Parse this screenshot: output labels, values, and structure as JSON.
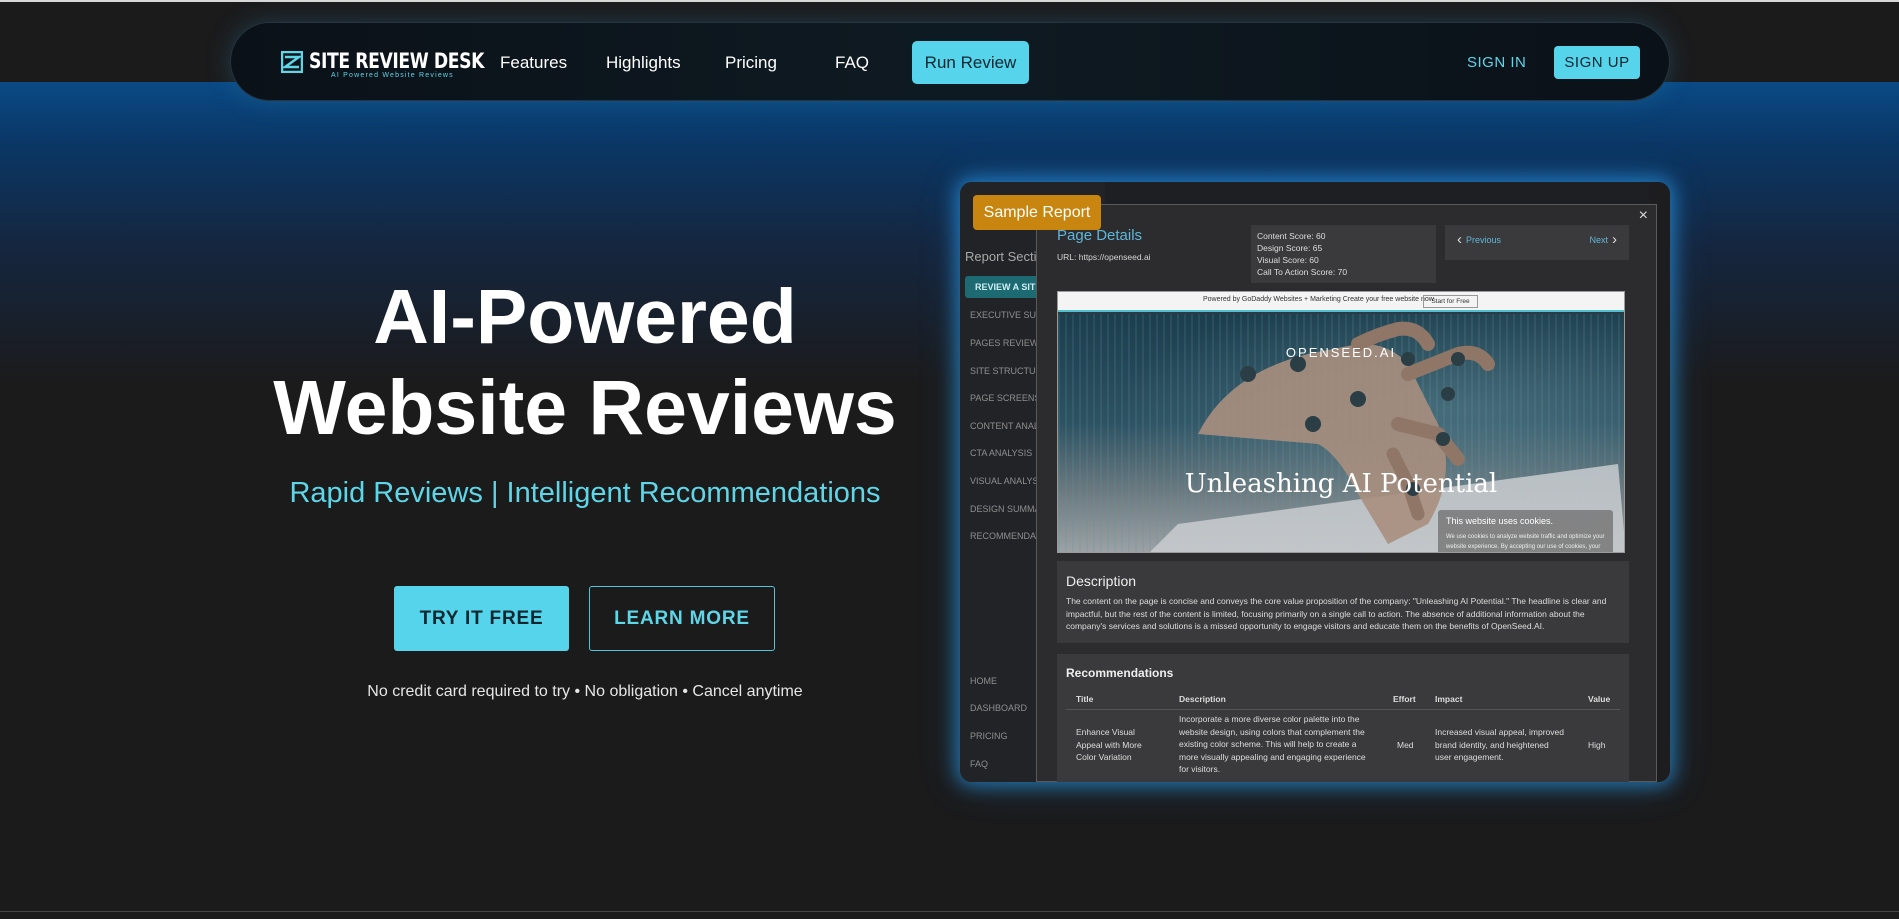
{
  "nav": {
    "logo_title": "SITE REVIEW DESK",
    "logo_subtitle": "AI Powered Website Reviews",
    "links": [
      "Features",
      "Highlights",
      "Pricing",
      "FAQ"
    ],
    "run_review": "Run Review",
    "sign_in": "SIGN IN",
    "sign_up": "SIGN UP"
  },
  "hero": {
    "title_line1": "AI-Powered",
    "title_line2": "Website Reviews",
    "subtitle": "Rapid Reviews | Intelligent Recommendations",
    "try_button": "TRY IT FREE",
    "learn_button": "LEARN MORE",
    "disclaimer": "No credit card required to try • No obligation • Cancel anytime"
  },
  "report": {
    "badge": "Sample Report",
    "sidebar": {
      "heading": "Report Secti",
      "active": "REVIEW A SITE",
      "items": [
        "EXECUTIVE SUM",
        "PAGES REVIEWS",
        "SITE STRUCTUR",
        "PAGE SCREENS",
        "CONTENT ANAL",
        "CTA ANALYSIS",
        "VISUAL ANALYS",
        "DESIGN SUMMA",
        "RECOMMENDAT"
      ],
      "bottom_items": [
        "HOME",
        "DASHBOARD",
        "PRICING",
        "FAQ"
      ]
    },
    "modal": {
      "close": "×",
      "title": "Page Details",
      "url": "URL: https://openseed.ai",
      "scores": [
        "Content Score: 60",
        "Design Score: 65",
        "Visual Score: 60",
        "Call To Action Score: 70"
      ],
      "previous": "Previous",
      "next": "Next",
      "screenshot": {
        "top_text": "Powered by GoDaddy Websites + Marketing  Create your free website now",
        "top_button": "Start for Free",
        "brand": "OPENSEED.AI",
        "headline": "Unleashing AI Potential",
        "cookie_title": "This website uses cookies.",
        "cookie_text": "We use cookies to analyze website traffic and optimize your website experience. By accepting our use of cookies, your data will be aggregated with all"
      },
      "description_heading": "Description",
      "description_text": "The content on the page is concise and conveys the core value proposition of the company: \"Unleashing AI Potential.\" The headline is clear and impactful, but the rest of the content is limited, focusing primarily on a single call to action. The absence of additional information about the company's services and solutions is a missed opportunity to engage visitors and educate them on the benefits of OpenSeed.AI.",
      "recommendations_heading": "Recommendations",
      "table_headers": [
        "Title",
        "Description",
        "Effort",
        "Impact",
        "Value"
      ],
      "row": {
        "title": "Enhance Visual Appeal with More Color Variation",
        "description": "Incorporate a more diverse color palette into the website design, using colors that complement the existing color scheme. This will help to create a more visually appealing and engaging experience for visitors.",
        "effort": "Med",
        "impact": "Increased visual appeal, improved brand identity, and heightened user engagement.",
        "value": "High"
      }
    }
  },
  "colors": {
    "accent": "#55d4ec",
    "badge": "#c8850f",
    "background": "#1b1b1c"
  }
}
